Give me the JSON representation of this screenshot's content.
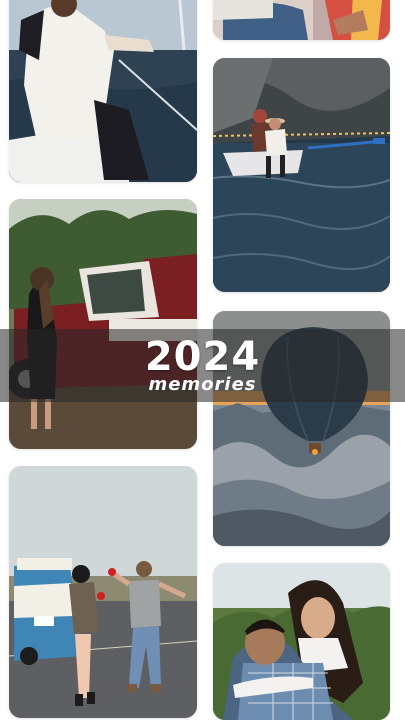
{
  "title": {
    "year": "2024",
    "subtitle": "memories"
  },
  "colors": {
    "banner": "#3a3a3a",
    "background": "#ffffff",
    "text": "#ffffff"
  },
  "photos": [
    {
      "name": "sailing",
      "description": "sailboat"
    },
    {
      "name": "red-truck",
      "description": "truck"
    },
    {
      "name": "road-trip",
      "description": "van"
    },
    {
      "name": "street-portrait",
      "description": "street"
    },
    {
      "name": "rowboat-lake",
      "description": "lake"
    },
    {
      "name": "hot-air-balloon",
      "description": "balloon"
    },
    {
      "name": "couple-piggyback",
      "description": "couple"
    }
  ]
}
